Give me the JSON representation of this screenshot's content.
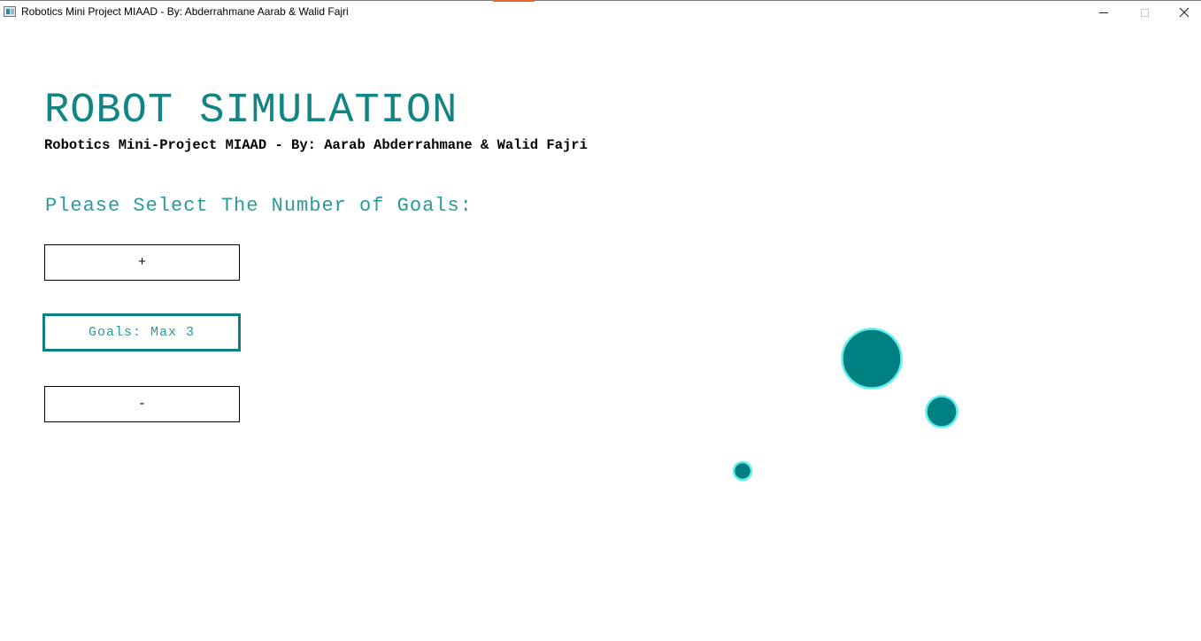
{
  "window": {
    "title": "Robotics Mini Project MIAAD - By: Abderrahmane Aarab & Walid Fajri",
    "icon": "app-window-icon",
    "controls": [
      "minimize-icon",
      "maximize-icon",
      "close-icon"
    ]
  },
  "colors": {
    "teal": "#0b8080",
    "title_teal": "#128484",
    "prompt_teal": "#2a9a9a",
    "goal_fill": "#008080",
    "goal_ring": "#5ff0f0",
    "accent_orange": "#e8642c"
  },
  "main": {
    "title": "ROBOT SIMULATION",
    "subtitle": "Robotics Mini-Project MIAAD - By: Aarab Abderrahmane & Walid Fajri",
    "prompt": "Please Select The Number of Goals:"
  },
  "controls": {
    "increment_label": "+",
    "goals_display": "Goals: Max 3",
    "decrement_label": "-"
  },
  "goals": {
    "count": 3
  }
}
